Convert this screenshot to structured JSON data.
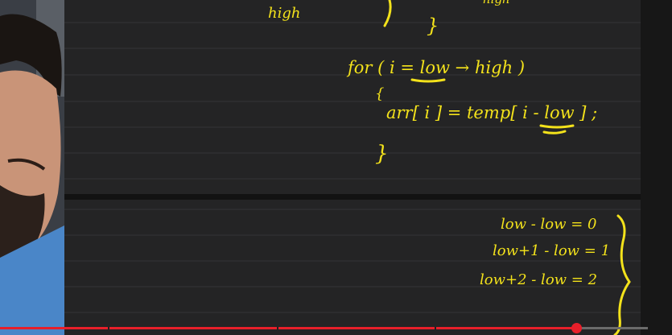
{
  "video": {
    "progress_fraction": 0.89,
    "colors": {
      "played": "#e81f2a",
      "ink": "#f3e21b",
      "board": "#242425"
    }
  },
  "notes": {
    "top_word": "high",
    "top_right_fragment": "high",
    "loop_line": "for ( i = low → high )",
    "assign_line": "arr[ i ] = temp[ i - low ] ;",
    "brace_open": "{",
    "brace_close": "}",
    "brace_top": "}",
    "derivation": [
      "low - low = 0",
      "low+1 - low = 1",
      "low+2 - low = 2"
    ]
  }
}
